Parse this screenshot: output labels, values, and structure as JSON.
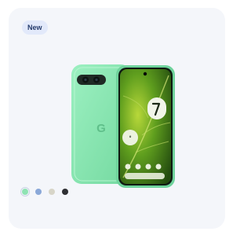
{
  "product_card": {
    "badge_label": "New",
    "image": {
      "icon": "pixel-phone-image",
      "back_logo": "G"
    },
    "color_swatches": [
      {
        "name": "aloe",
        "color": "#8fe3b3",
        "selected": true
      },
      {
        "name": "bay",
        "color": "#8aa8d8",
        "selected": false
      },
      {
        "name": "porcelain",
        "color": "#d7d5c8",
        "selected": false
      },
      {
        "name": "obsidian",
        "color": "#2e2f33",
        "selected": false
      }
    ]
  }
}
